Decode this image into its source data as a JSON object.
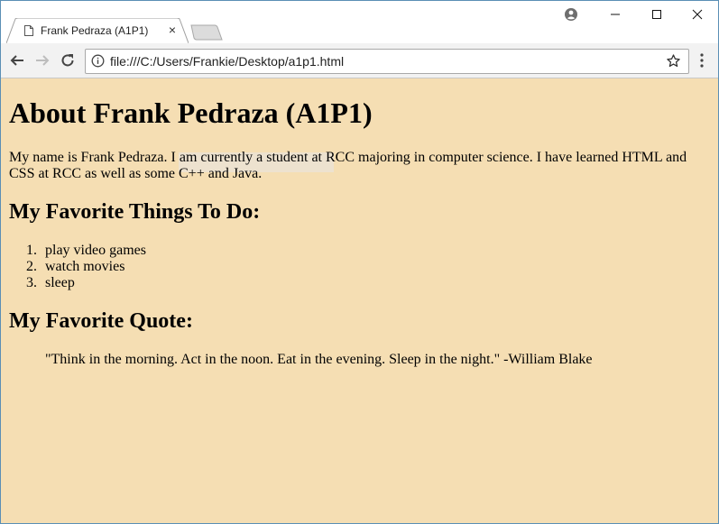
{
  "browser": {
    "tab": {
      "title": "Frank Pedraza (A1P1)",
      "close_glyph": "×",
      "favicon": "page-icon"
    },
    "new_tab_icon": "new-tab-icon",
    "profile_icon": "account-circle-icon",
    "window_controls": [
      "minimize-icon",
      "maximize-icon",
      "close-icon"
    ],
    "toolbar": {
      "back_icon": "arrow-left-icon",
      "forward_icon": "arrow-right-icon",
      "reload_icon": "reload-icon",
      "info_icon": "info-icon",
      "url": "file:///C:/Users/Frankie/Desktop/a1p1.html",
      "bookmark_icon": "star-icon",
      "menu_icon": "kebab-menu-icon"
    }
  },
  "page": {
    "background": "#f5deb3",
    "heading": "About Frank Pedraza (A1P1)",
    "intro": "My name is Frank Pedraza. I am currently a student at RCC majoring in computer science. I have learned HTML and CSS at RCC as well as some C++ and Java.",
    "things_heading": "My Favorite Things To Do:",
    "things": [
      {
        "num": "1.",
        "text": "play video games"
      },
      {
        "num": "2.",
        "text": "watch movies"
      },
      {
        "num": "3.",
        "text": "sleep"
      }
    ],
    "quote_heading": "My Favorite Quote:",
    "quote": "\"Think in the morning. Act in the noon. Eat in the evening. Sleep in the night.\" -William Blake"
  }
}
